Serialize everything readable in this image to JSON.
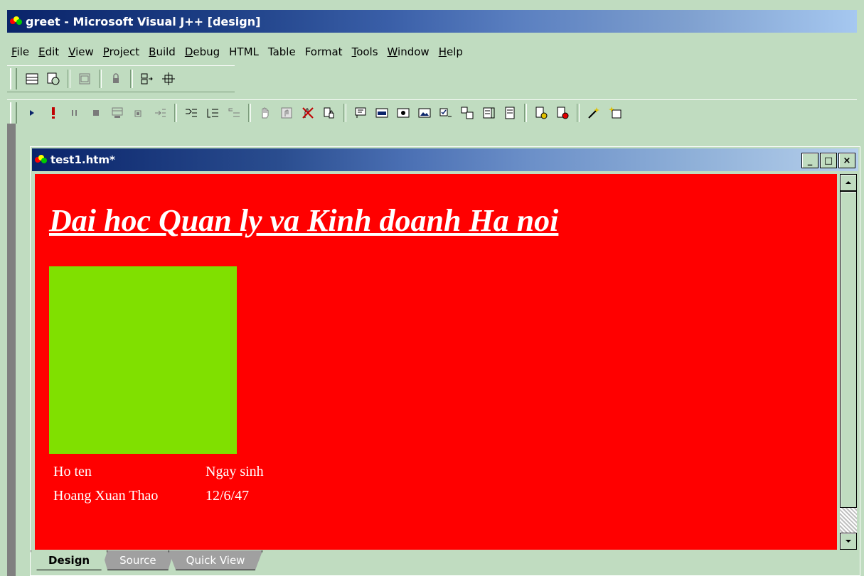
{
  "app": {
    "title": "greet - Microsoft Visual J++ [design]"
  },
  "menu": [
    {
      "label": "File",
      "underline": "F",
      "rest": "ile"
    },
    {
      "label": "Edit",
      "underline": "E",
      "rest": "dit"
    },
    {
      "label": "View",
      "underline": "V",
      "rest": "iew"
    },
    {
      "label": "Project",
      "underline": "P",
      "rest": "roject"
    },
    {
      "label": "Build",
      "underline": "B",
      "rest": "uild"
    },
    {
      "label": "Debug",
      "underline": "D",
      "rest": "ebug"
    },
    {
      "label": "HTML",
      "underline": "",
      "rest": "HTML"
    },
    {
      "label": "Table",
      "underline": "",
      "rest": "Table"
    },
    {
      "label": "Format",
      "underline": "",
      "rest": "Format"
    },
    {
      "label": "Tools",
      "underline": "T",
      "rest": "ools"
    },
    {
      "label": "Window",
      "underline": "W",
      "rest": "indow"
    },
    {
      "label": "Help",
      "underline": "H",
      "rest": "elp"
    }
  ],
  "document": {
    "title": "test1.htm*",
    "heading": "Dai hoc Quan ly va Kinh doanh Ha noi",
    "table": {
      "header": [
        "Ho ten",
        "Ngay sinh"
      ],
      "row": [
        "Hoang Xuan Thao",
        "12/6/47"
      ]
    },
    "colors": {
      "background": "#ff0000",
      "box": "#80e000",
      "text": "#ffffff"
    }
  },
  "window_buttons": {
    "minimize": "_",
    "maximize": "□",
    "close": "×"
  },
  "tabs": [
    {
      "label": "Design",
      "active": true
    },
    {
      "label": "Source",
      "active": false
    },
    {
      "label": "Quick View",
      "active": false
    }
  ]
}
